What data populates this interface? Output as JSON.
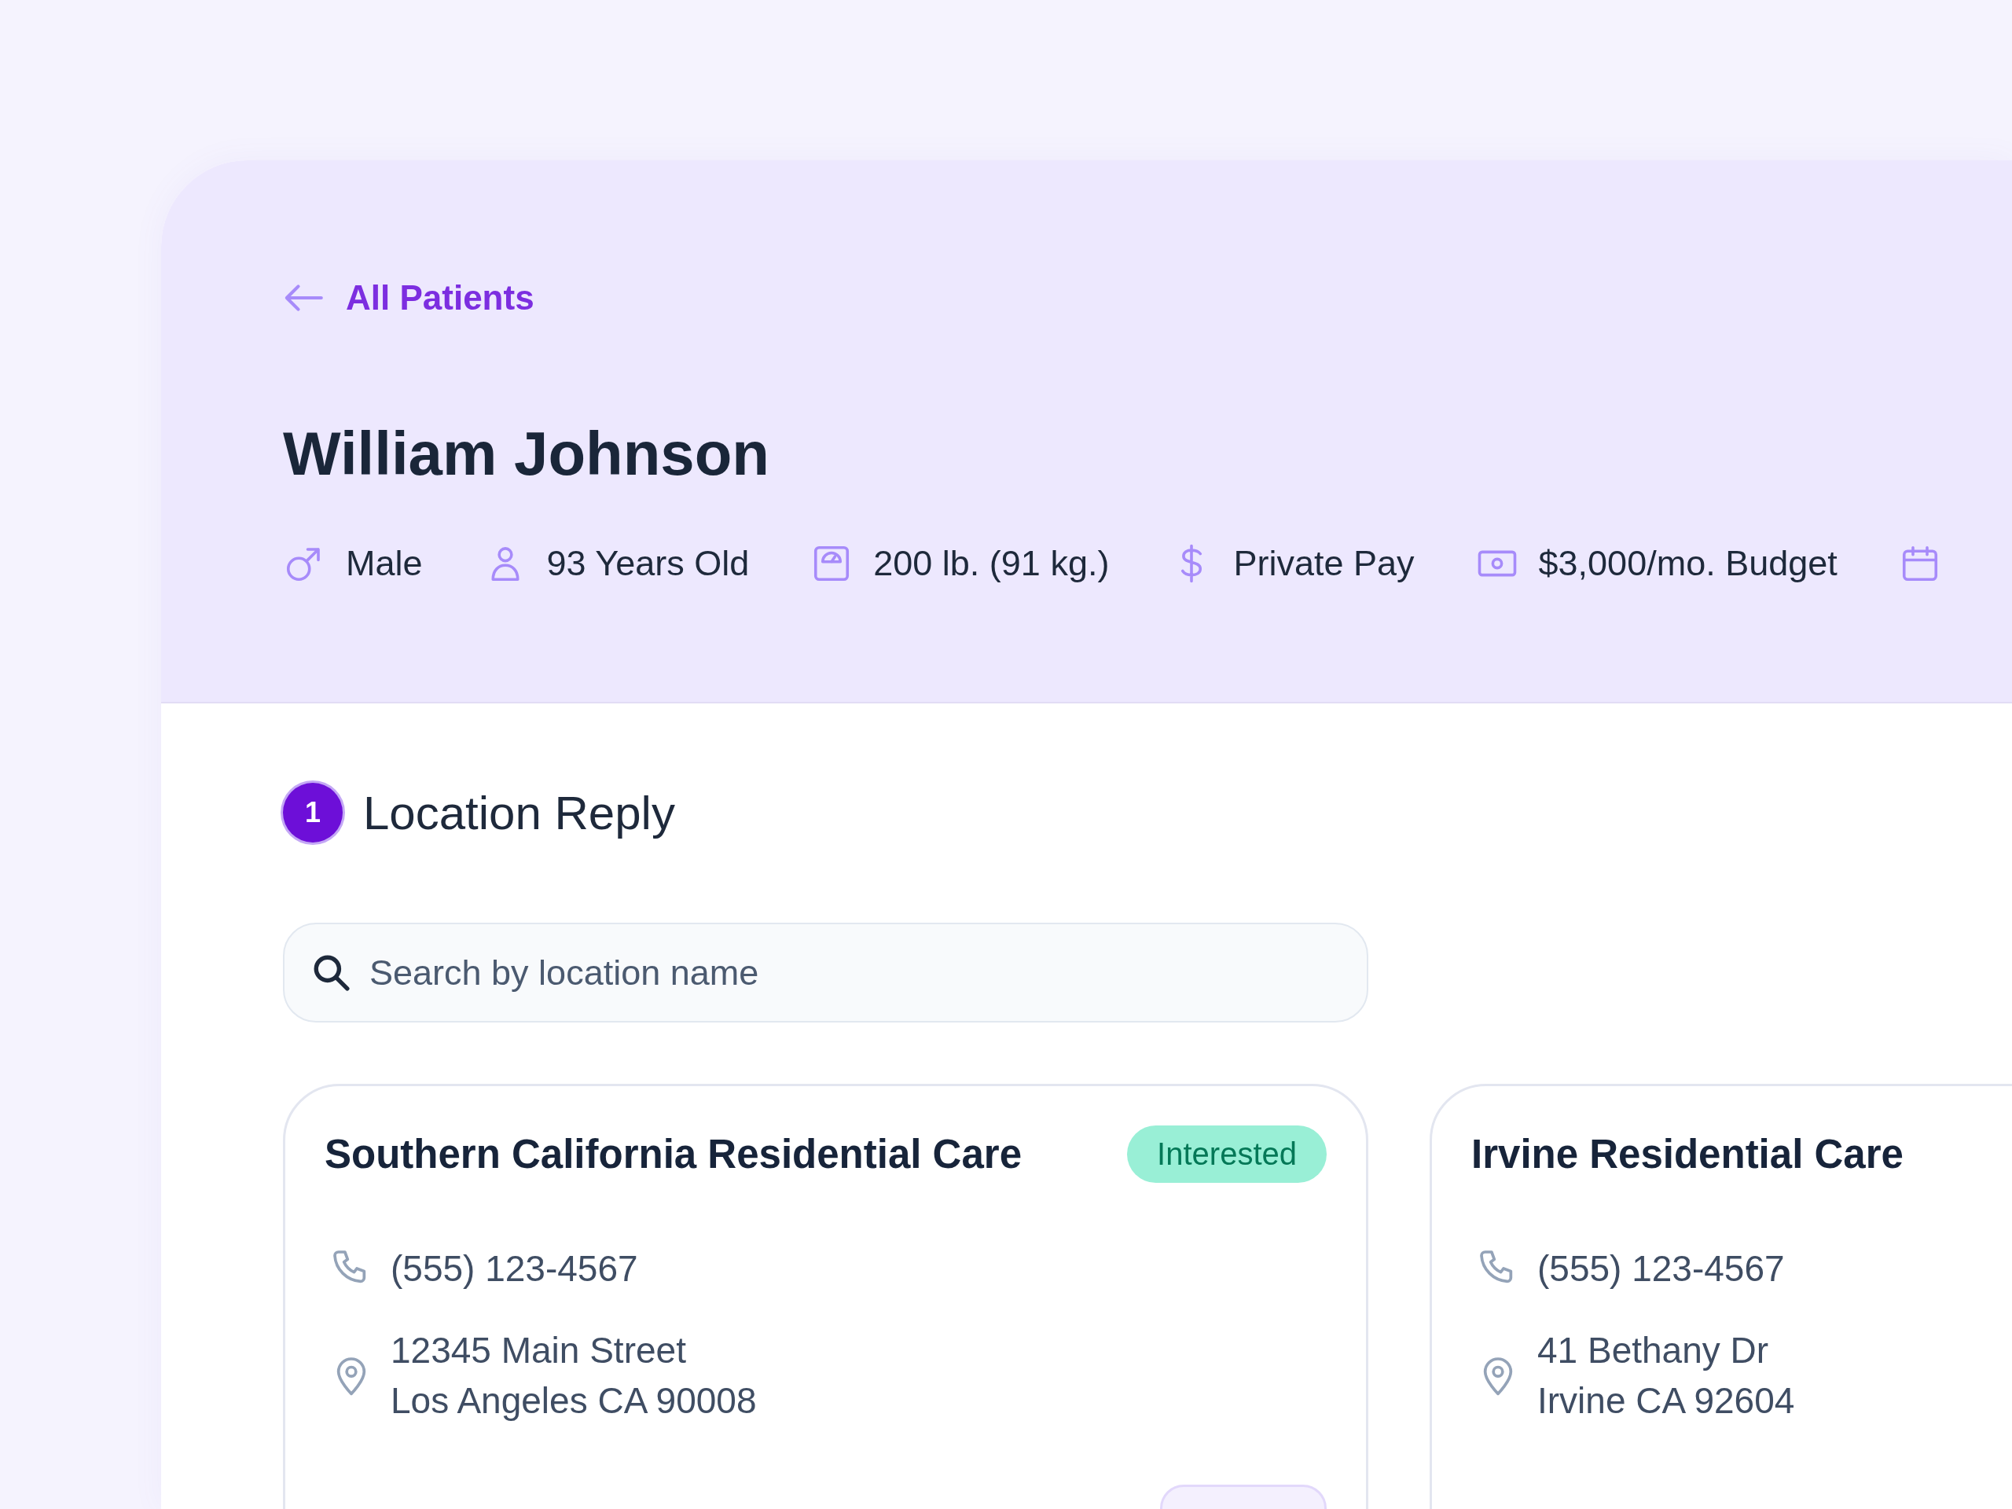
{
  "back_link": {
    "label": "All Patients"
  },
  "patient": {
    "name": "William Johnson",
    "facts": [
      {
        "kind": "gender",
        "text": "Male"
      },
      {
        "kind": "age",
        "text": "93 Years Old"
      },
      {
        "kind": "weight",
        "text": "200 lb. (91 kg.)"
      },
      {
        "kind": "payment",
        "text": "Private Pay"
      },
      {
        "kind": "budget",
        "text": "$3,000/mo. Budget"
      },
      {
        "kind": "date"
      }
    ]
  },
  "section": {
    "step": "1",
    "title": "Location Reply"
  },
  "search": {
    "placeholder": "Search by location name"
  },
  "locations": [
    {
      "name": "Southern California Residential Care",
      "status": "Interested",
      "phone": "(555) 123-4567",
      "address_lines": [
        "12345 Main Street",
        "Los Angeles CA 90008"
      ],
      "has_action": true
    },
    {
      "name": "Irvine Residential Care",
      "phone": "(555) 123-4567",
      "address_lines": [
        "41 Bethany Dr",
        "Irvine CA 92604"
      ],
      "has_action": false
    }
  ]
}
